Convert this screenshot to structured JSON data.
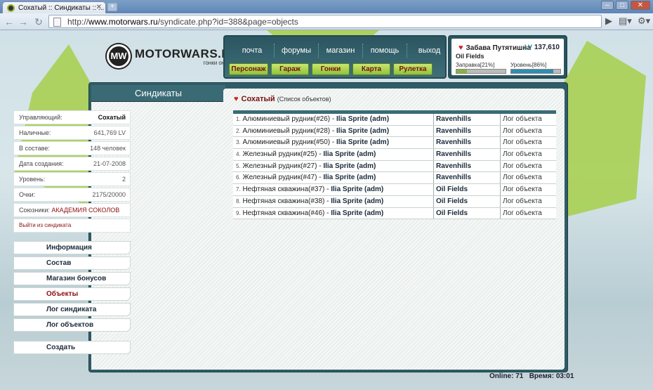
{
  "browser": {
    "tab_title": "Сохатый :: Синдикаты :: ...",
    "url_scheme": "http://",
    "url_host": "www.motorwars.ru",
    "url_path": "/syndicate.php?id=388&page=objects"
  },
  "site": {
    "logo_mark": "MW",
    "logo_name": "MOTORWARS.RU",
    "logo_tagline": "гонки он-лайн"
  },
  "topnav": {
    "row1": [
      "почта",
      "форумы",
      "магазин",
      "помощь",
      "выход"
    ],
    "row2": [
      "Персонаж",
      "Гараж",
      "Гонки",
      "Карта",
      "Рулетка"
    ]
  },
  "user": {
    "name": "Забава Путятишна",
    "level_label": "LV",
    "level_value": "137,610",
    "club": "Oil Fields",
    "fuel_label": "Заправка[21%]",
    "fuel_percent": 21,
    "level_progress_label": "Уровень[86%]",
    "level_percent": 86
  },
  "sidebar": {
    "title": "Синдикаты",
    "info": [
      {
        "label": "Управляющий:",
        "value": "Сохатый"
      },
      {
        "label": "Наличные:",
        "value": "641,769 LV"
      },
      {
        "label": "В составе:",
        "value": "148 человек"
      },
      {
        "label": "Дата создания:",
        "value": "21-07-2008"
      },
      {
        "label": "Уровень:",
        "value": "2"
      },
      {
        "label": "Очки:",
        "value": "2175/20000"
      }
    ],
    "allies_label": "Союзники:",
    "allies_value": "АКАДЕМИЯ СОКОЛОВ",
    "leave_label": "Выйти из синдиката",
    "menu": [
      "Информация",
      "Состав",
      "Магазин бонусов",
      "Объекты",
      "Лог синдиката",
      "Лог объектов"
    ],
    "create_label": "Создать"
  },
  "content": {
    "title": "Сохатый",
    "subtitle": "(Список объектов)",
    "rows": [
      {
        "num": "1.",
        "object": "Алюминиевый рудник(#26)",
        "owner": "Ilia Sprite (adm)",
        "location": "Ravenhills",
        "log": "Лог объекта"
      },
      {
        "num": "2.",
        "object": "Алюминиевый рудник(#28)",
        "owner": "Ilia Sprite (adm)",
        "location": "Ravenhills",
        "log": "Лог объекта"
      },
      {
        "num": "3.",
        "object": "Алюминиевый рудник(#50)",
        "owner": "Ilia Sprite (adm)",
        "location": "Ravenhills",
        "log": "Лог объекта"
      },
      {
        "num": "4.",
        "object": "Железный рудник(#25)",
        "owner": "Ilia Sprite (adm)",
        "location": "Ravenhills",
        "log": "Лог объекта"
      },
      {
        "num": "5.",
        "object": "Железный рудник(#27)",
        "owner": "Ilia Sprite (adm)",
        "location": "Ravenhills",
        "log": "Лог объекта"
      },
      {
        "num": "6.",
        "object": "Железный рудник(#47)",
        "owner": "Ilia Sprite (adm)",
        "location": "Ravenhills",
        "log": "Лог объекта"
      },
      {
        "num": "7.",
        "object": "Нефтяная скважина(#37)",
        "owner": "Ilia Sprite (adm)",
        "location": "Oil Fields",
        "log": "Лог объекта"
      },
      {
        "num": "8.",
        "object": "Нефтяная скважина(#38)",
        "owner": "Ilia Sprite (adm)",
        "location": "Oil Fields",
        "log": "Лог объекта"
      },
      {
        "num": "9.",
        "object": "Нефтяная скважина(#46)",
        "owner": "Ilia Sprite (adm)",
        "location": "Oil Fields",
        "log": "Лог объекта"
      }
    ]
  },
  "footer": {
    "online_label": "Online:",
    "online_value": "71",
    "time_label": "Время:",
    "time_value": "03:01"
  }
}
